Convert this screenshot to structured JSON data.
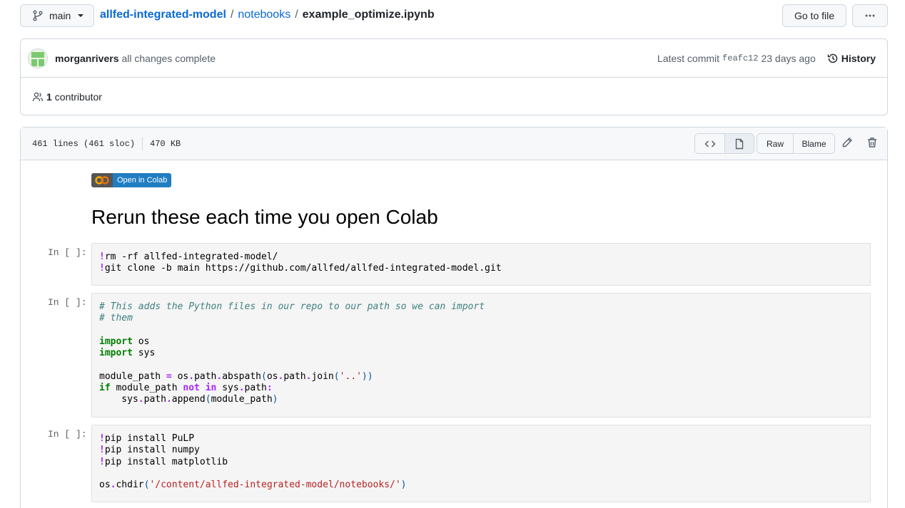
{
  "topbar": {
    "branch": "main",
    "repo": "allfed-integrated-model",
    "sep1": "/",
    "folder": "notebooks",
    "sep2": "/",
    "file": "example_optimize.ipynb",
    "goto_label": "Go to file"
  },
  "commit": {
    "author": "morganrivers",
    "message": "all changes complete",
    "latest_label": "Latest commit",
    "sha": "feafc12",
    "age": "23 days ago",
    "history_label": "History"
  },
  "contributors": {
    "count": "1",
    "label": "contributor"
  },
  "file_header": {
    "lines": "461 lines (461 sloc)",
    "size": "470 KB",
    "raw_label": "Raw",
    "blame_label": "Blame"
  },
  "notebook": {
    "badge_label": "Open in Colab",
    "title": "Rerun these each time you open Colab",
    "cells": [
      {
        "prompt": "In [ ]:"
      },
      {
        "prompt": "In [ ]:"
      },
      {
        "prompt": "In [ ]:"
      }
    ],
    "code": {
      "c1": [
        "rm -rf allfed-integrated-model/",
        "git clone -b main https://github.com/allfed/allfed-integrated-model.git"
      ],
      "c2_comments": [
        "# This adds the Python files in our repo to our path so we can import",
        "# them"
      ],
      "c2_import1": "os",
      "c2_import2": "sys",
      "c3_pips": [
        "pip install PuLP",
        "pip install numpy",
        "pip install matplotlib"
      ],
      "c3_chdir_str": "'/content/allfed-integrated-model/notebooks/'"
    }
  },
  "colors": {
    "link": "#0969da",
    "badge_blue": "#1f7ec2"
  }
}
